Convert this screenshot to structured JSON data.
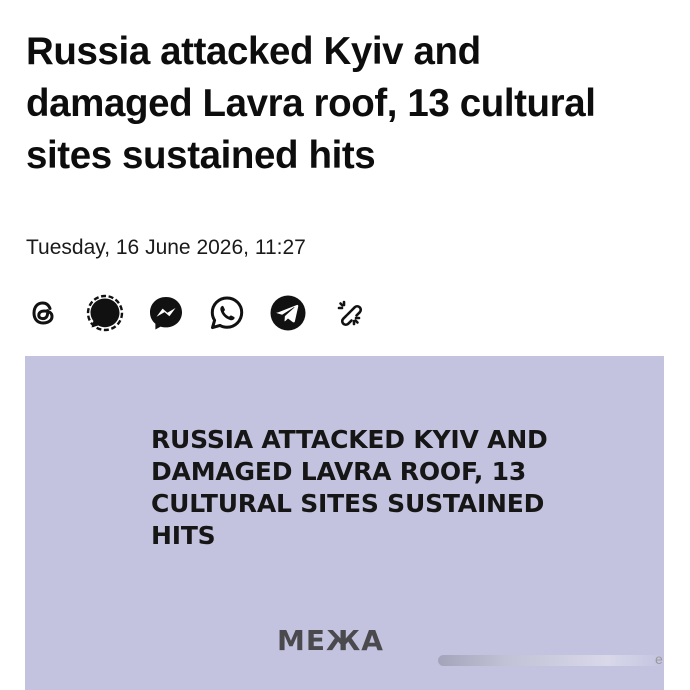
{
  "article": {
    "headline_lines": [
      "Russia attacked Kyiv and",
      "damaged Lavra roof, 13 cultural",
      "sites sustained hits"
    ],
    "dateline": "Tuesday, 16 June 2026, 11:27"
  },
  "share": {
    "items": [
      {
        "name": "threads",
        "icon": "threads-icon"
      },
      {
        "name": "signal",
        "icon": "signal-icon"
      },
      {
        "name": "messenger",
        "icon": "messenger-icon"
      },
      {
        "name": "whatsapp",
        "icon": "whatsapp-icon"
      },
      {
        "name": "telegram",
        "icon": "telegram-icon"
      },
      {
        "name": "copy-link",
        "icon": "link-icon"
      }
    ]
  },
  "hero": {
    "title_lines": [
      "RUSSIA ATTACKED KYIV AND",
      "DAMAGED LAVRA ROOF, 13",
      "CULTURAL SITES SUSTAINED",
      "HITS"
    ],
    "logo_text": "МЕЖА",
    "background_color": "#c3c3e0"
  },
  "overlay": {
    "tail_char": "e"
  }
}
